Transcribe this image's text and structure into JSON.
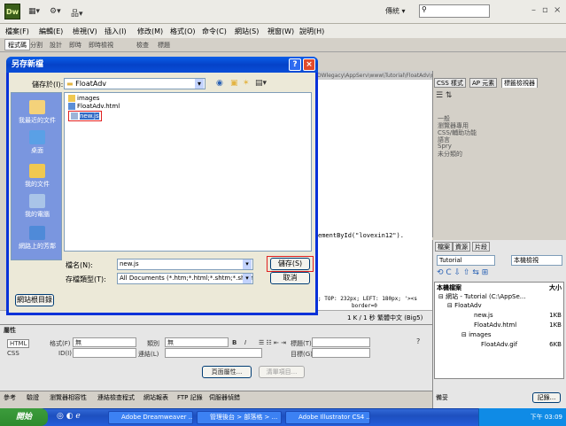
{
  "app": {
    "logo": "Dw",
    "toolbar_icons": [
      "layout-icon",
      "gear-icon",
      "site-icon"
    ],
    "workspace_label": "傳統 ▾",
    "search_placeholder": "",
    "window_controls": [
      "–",
      "▫",
      "×"
    ]
  },
  "menu": [
    "檔案(F)",
    "編輯(E)",
    "檢視(V)",
    "插入(I)",
    "修改(M)",
    "格式(O)",
    "命令(C)",
    "網站(S)",
    "視窗(W)",
    "說明(H)"
  ],
  "doc_tabs": [
    "程式碼",
    "分割",
    "設計",
    "即時",
    "即時檢視",
    "檢查",
    "標題"
  ],
  "code_tab_path": "DWlegacy\\AppServ\\www\\Tutorial\\FloatAdv\\new.js",
  "code_lines": [
    "ementById(\"lovexin12\").",
    "",
    "",
    "",
    "; TOP: 232px; LEFT: 180px; '><s",
    "border=0"
  ],
  "status_text": "1 K / 1 秒  繁體中文 (Big5)",
  "right_panel": {
    "tabs": [
      "CSS 樣式",
      "AP 元素",
      "標籤檢視器"
    ],
    "items": [
      "一般",
      "瀏覽器專用",
      "CSS/輔助功能",
      "語言",
      "Spry",
      "未分類的"
    ]
  },
  "files_panel": {
    "tabs": [
      "檔案",
      "資源",
      "片段"
    ],
    "site_select": "Tutorial",
    "view_select": "本機檢視",
    "header_left": "本機檔案",
    "header_right": "大小",
    "tree": [
      {
        "name": "網站 - Tutorial (C:\\AppSe...",
        "size": ""
      },
      {
        "name": "FloatAdv",
        "size": ""
      },
      {
        "name": "new.js",
        "size": "1KB"
      },
      {
        "name": "FloatAdv.html",
        "size": "1KB"
      },
      {
        "name": "images",
        "size": ""
      },
      {
        "name": "FloatAdv.gif",
        "size": "6KB"
      }
    ],
    "log_label": "記錄...",
    "ready_label": "備妥"
  },
  "properties": {
    "title": "屬性",
    "html_label": "HTML",
    "css_label": "CSS",
    "format_label": "格式(F)",
    "format_value": "無",
    "class_label": "類別",
    "class_value": "無",
    "id_label": "ID(I)",
    "link_label": "連結(L)",
    "title_label": "標題(T)",
    "target_label": "目標(G)",
    "page_props": "頁面屬性...",
    "list_item": "清單項目..."
  },
  "bottom_tabs": [
    "參考",
    "驗證",
    "瀏覽器相容性",
    "連結檢查程式",
    "網站報表",
    "FTP 記錄",
    "伺服器偵錯"
  ],
  "dialog": {
    "title": "另存新檔",
    "save_in_label": "儲存於(I):",
    "save_in_value": "FloatAdv",
    "places": [
      "我最近的文件",
      "桌面",
      "我的文件",
      "我的電腦",
      "網路上的芳鄰"
    ],
    "files": [
      "images",
      "FloatAdv.html",
      "new.js"
    ],
    "filename_label": "檔名(N):",
    "filename_value": "new.js",
    "filetype_label": "存檔類型(T):",
    "filetype_value": "All Documents (*.htm;*.html;*.shtm;*.shtml;*.",
    "save_button": "儲存(S)",
    "cancel_button": "取消",
    "site_root_button": "網站根目錄"
  },
  "taskbar": {
    "start": "開始",
    "buttons": [
      "Adobe Dreamweaver ...",
      "管理後台 > 部落格 > ...",
      "Adobe Illustrator CS4 ..."
    ],
    "clock": "下午 03:09"
  }
}
